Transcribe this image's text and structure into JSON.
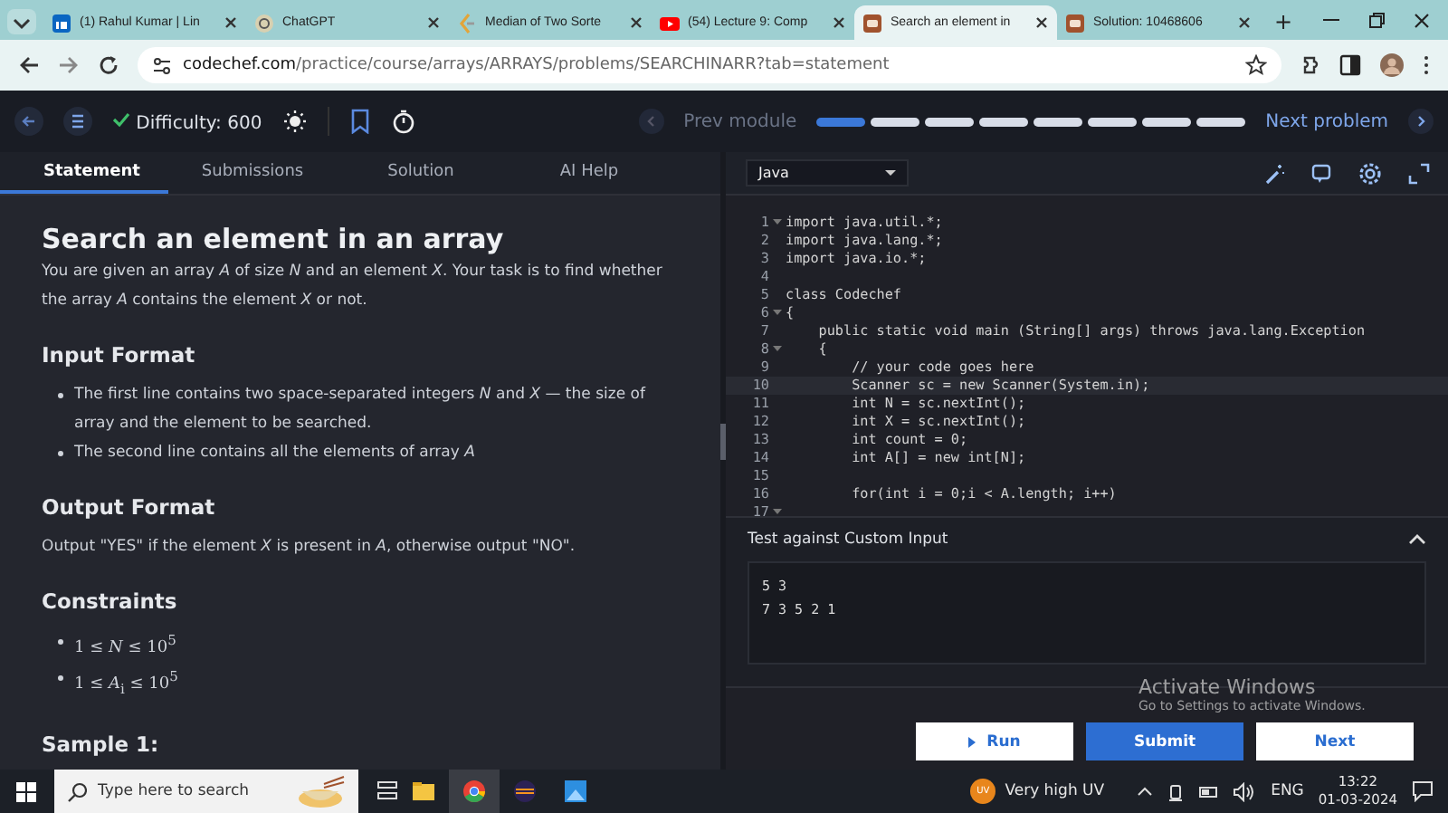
{
  "browser": {
    "tabs": [
      {
        "title": "(1) Rahul Kumar | Lin",
        "selected": false
      },
      {
        "title": "ChatGPT",
        "selected": false
      },
      {
        "title": "Median of Two Sorte",
        "selected": false
      },
      {
        "title": "(54) Lecture 9: Comp",
        "selected": false
      },
      {
        "title": "Search an element in",
        "selected": true
      },
      {
        "title": "Solution: 10468606",
        "selected": false
      }
    ],
    "new_tab": "+",
    "url_host": "codechef.com",
    "url_path": "/practice/course/arrays/ARRAYS/problems/SEARCHINARR?tab=statement"
  },
  "header": {
    "difficulty_label": "Difficulty:",
    "difficulty": "600",
    "prev": "Prev module",
    "next": "Next problem",
    "progress": [
      {
        "completed": true
      },
      {
        "completed": false
      },
      {
        "completed": false
      },
      {
        "completed": false
      },
      {
        "completed": false
      },
      {
        "completed": false
      },
      {
        "completed": false
      },
      {
        "completed": false
      }
    ]
  },
  "tabs": [
    {
      "label": "Statement",
      "selected": true
    },
    {
      "label": "Submissions",
      "selected": false
    },
    {
      "label": "Solution",
      "selected": false
    },
    {
      "label": "AI Help",
      "selected": false
    }
  ],
  "problem": {
    "title": "Search an element in an array",
    "intro": "You are given an array *A* of size *N* and an element *X*. Your task is to find whether the array *A* contains the element *X* or not.",
    "sections": [
      {
        "heading": "Input Format",
        "kind": "bullets",
        "items": [
          "The first line contains two space-separated integers *N* and *X* — the size of array and the element to be searched.",
          "The second line contains all the elements of array *A*"
        ]
      },
      {
        "heading": "Output Format",
        "kind": "text",
        "text": "Output \"YES\" if the element *X* is present in *A*, otherwise output \"NO\"."
      },
      {
        "heading": "Constraints",
        "kind": "math",
        "items": [
          "1 ≤ *N* ≤ 10$^{5}$",
          "1 ≤ *A*$_{i}$ ≤ 10$^{5}$"
        ]
      },
      {
        "heading": "Sample 1:",
        "kind": "sample"
      }
    ]
  },
  "editor": {
    "language": "Java",
    "lines": [
      {
        "n": "1",
        "text": "import java.util.*;",
        "fold": true
      },
      {
        "n": "2",
        "text": "import java.lang.*;",
        "fold": false
      },
      {
        "n": "3",
        "text": "import java.io.*;",
        "fold": false
      },
      {
        "n": "4",
        "fold": false
      },
      {
        "n": "5",
        "text": "class Codechef",
        "fold": false
      },
      {
        "n": "6",
        "text": "{",
        "fold": true
      },
      {
        "n": "7",
        "text": "    public static void main (String[] args) throws java.lang.Exception",
        "fold": false
      },
      {
        "n": "8",
        "text": "    {",
        "fold": true
      },
      {
        "n": "9",
        "text": "        // your code goes here",
        "fold": false
      },
      {
        "n": "10",
        "text": "        Scanner sc = new Scanner(System.in);",
        "fold": false
      },
      {
        "n": "11",
        "text": "        int N = sc.nextInt();",
        "fold": false
      },
      {
        "n": "12",
        "text": "        int X = sc.nextInt();",
        "fold": false
      },
      {
        "n": "13",
        "text": "        int count = 0;",
        "fold": false
      },
      {
        "n": "14",
        "text": "        int A[] = new int[N];",
        "fold": false
      },
      {
        "n": "15",
        "fold": false
      },
      {
        "n": "16",
        "text": "        for(int i = 0;i < A.length; i++)",
        "fold": false
      },
      {
        "n": "17",
        "fold": true
      }
    ],
    "custom_input": {
      "title": "Test against Custom Input",
      "expanded": true,
      "lines": [
        "5 3",
        "7 3 5 2 1"
      ]
    },
    "buttons": {
      "run": "Run",
      "submit": "Submit",
      "next": "Next"
    }
  },
  "os_notice": {
    "title": "Activate Windows",
    "text": "Go to Settings to activate Windows."
  },
  "taskbar": {
    "search_placeholder": "Type here to search",
    "weather": "Very high UV",
    "weather_badge": "UV",
    "language": "ENG",
    "time": "13:22",
    "date": "01-03-2024"
  }
}
